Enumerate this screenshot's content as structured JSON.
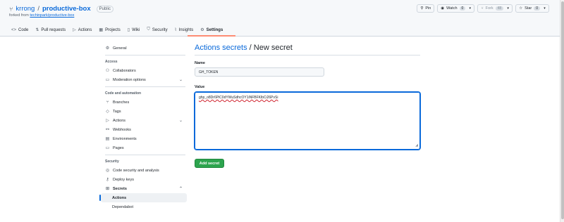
{
  "repo": {
    "owner": "krrong",
    "separator": "/",
    "name": "productive-box",
    "visibility": "Public",
    "forked_prefix": "forked from",
    "forked_from": "techinpark/productive-box"
  },
  "header_actions": {
    "pin": "Pin",
    "watch": "Watch",
    "watch_count": "0",
    "fork": "Fork",
    "fork_count": "48",
    "star": "Star",
    "star_count": "0"
  },
  "tabs": [
    {
      "label": "Code",
      "icon": "code-icon"
    },
    {
      "label": "Pull requests",
      "icon": "pull-request-icon"
    },
    {
      "label": "Actions",
      "icon": "play-icon"
    },
    {
      "label": "Projects",
      "icon": "table-icon"
    },
    {
      "label": "Wiki",
      "icon": "book-icon"
    },
    {
      "label": "Security",
      "icon": "shield-icon"
    },
    {
      "label": "Insights",
      "icon": "graph-icon"
    },
    {
      "label": "Settings",
      "icon": "gear-icon",
      "active": true
    }
  ],
  "sidebar": {
    "general": "General",
    "access_heading": "Access",
    "collaborators": "Collaborators",
    "moderation": "Moderation options",
    "code_heading": "Code and automation",
    "branches": "Branches",
    "tags": "Tags",
    "actions": "Actions",
    "webhooks": "Webhooks",
    "environments": "Environments",
    "pages": "Pages",
    "security_heading": "Security",
    "code_security": "Code security and analysis",
    "deploy_keys": "Deploy keys",
    "secrets": "Secrets",
    "secrets_actions": "Actions",
    "secrets_dependabot": "Dependabot"
  },
  "main": {
    "title_link": "Actions secrets",
    "title_rest": " / New secret",
    "name_label": "Name",
    "name_value": "GH_TOKEN",
    "value_label": "Value",
    "value_text": "ghp_o8Dr6PiC0dYWuSdhcOY1iNFBFKlbCi26PvSi",
    "submit": "Add secret"
  },
  "colors": {
    "accent": "#0969da",
    "primary_button": "#2da44e",
    "active_tab_underline": "#fd8c73"
  }
}
